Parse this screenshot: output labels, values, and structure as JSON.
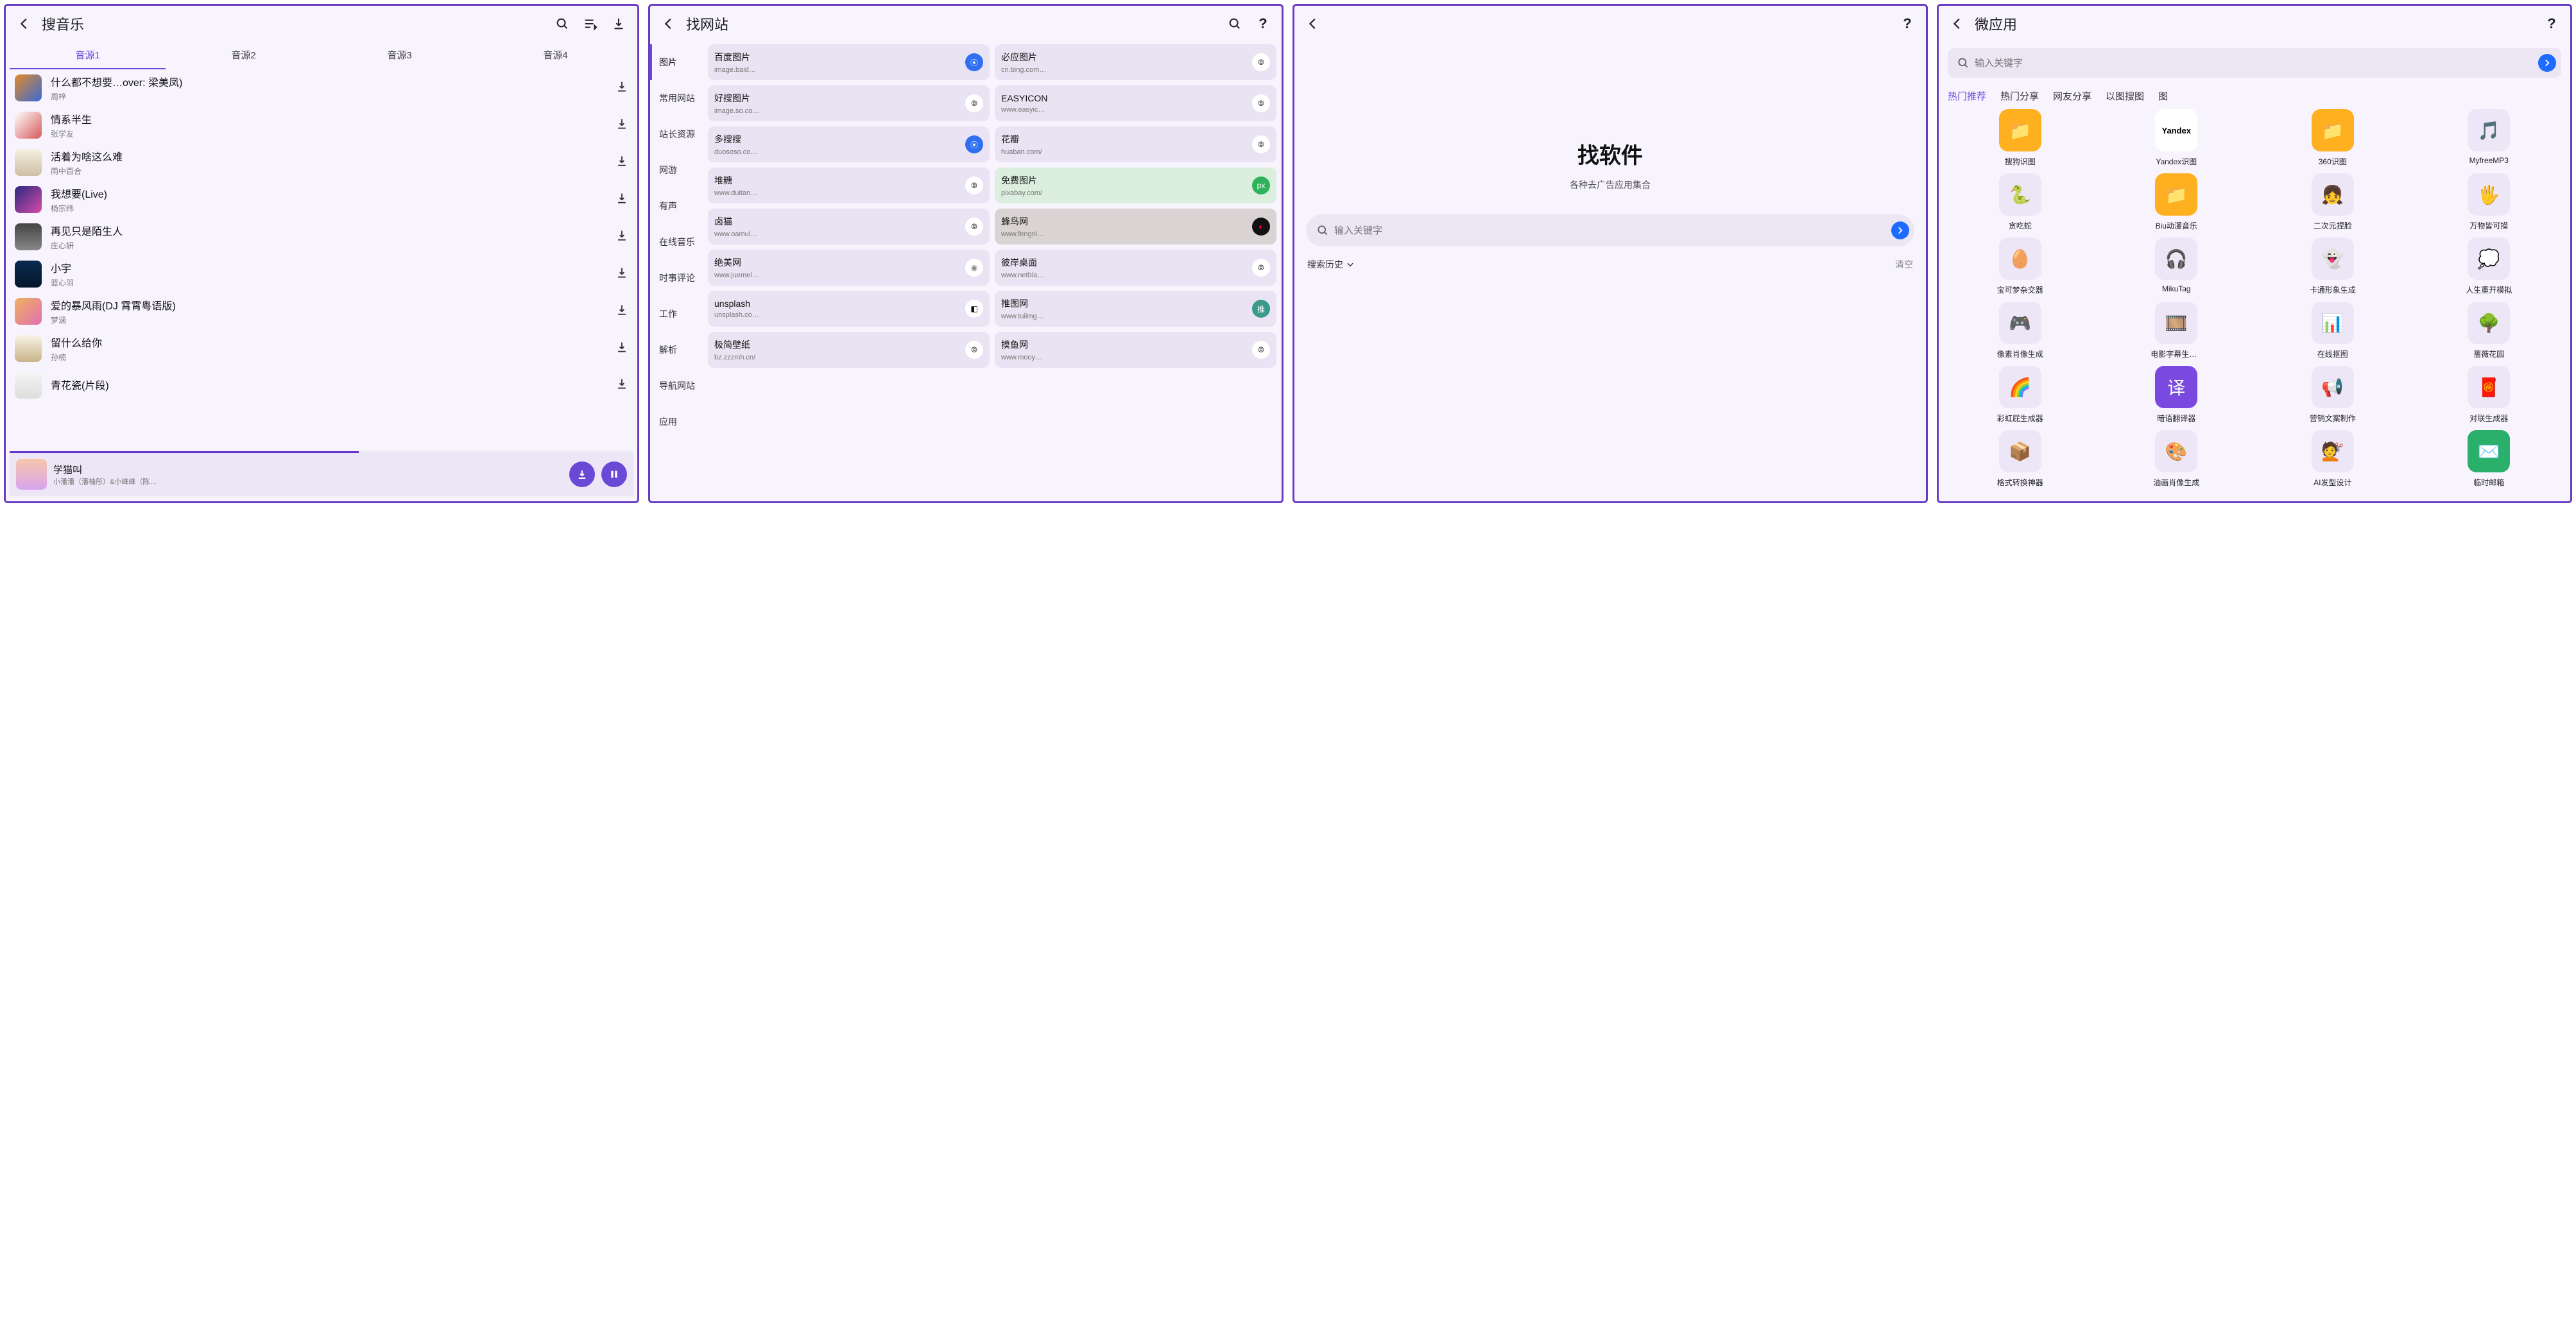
{
  "screen1": {
    "title": "搜音乐",
    "tabs": [
      "音源1",
      "音源2",
      "音源3",
      "音源4"
    ],
    "active_tab": 0,
    "songs": [
      {
        "title": "什么都不想要…over: 梁美凤)",
        "artist": "周梓",
        "thumb": "linear-gradient(135deg,#e08a2a,#3a6bd6)"
      },
      {
        "title": "情系半生",
        "artist": "张学友",
        "thumb": "linear-gradient(135deg,#fff,#d65a5a)"
      },
      {
        "title": "活着为啥这么难",
        "artist": "雨中百合",
        "thumb": "linear-gradient(#f5f0e1,#cdbfa5)"
      },
      {
        "title": "我想要(Live)",
        "artist": "杨宗纬",
        "thumb": "linear-gradient(135deg,#2a2a80,#d64aa8)"
      },
      {
        "title": "再见只是陌生人",
        "artist": "庄心妍",
        "thumb": "linear-gradient(#444,#888)"
      },
      {
        "title": "小宇",
        "artist": "蓝心羽",
        "thumb": "linear-gradient(#0a2a50,#05162a)"
      },
      {
        "title": "爱的暴风雨(DJ 霄霄粤语版)",
        "artist": "梦涵",
        "thumb": "linear-gradient(135deg,#f0b060,#e070b0)"
      },
      {
        "title": "留什么给你",
        "artist": "孙楠",
        "thumb": "linear-gradient(#f7f3e6,#c9b488)"
      },
      {
        "title": "青花瓷(片段)",
        "artist": "",
        "thumb": "linear-gradient(#f5f5f5,#ddd)"
      }
    ],
    "player": {
      "title": "学猫叫",
      "artist": "小潘潘（潘柚彤）&小峰峰（陈…"
    }
  },
  "screen2": {
    "title": "找网站",
    "categories": [
      "图片",
      "常用网站",
      "站长资源",
      "网游",
      "有声",
      "在线音乐",
      "时事评论",
      "工作",
      "解析",
      "导航网站",
      "应用"
    ],
    "active_cat": 0,
    "sites": [
      {
        "name": "百度图片",
        "url": "image.baid…",
        "iconText": "",
        "iconBg": "#2f6ff0",
        "iconColor": "#fff"
      },
      {
        "name": "必应图片",
        "url": "cn.bing.com…",
        "iconText": "⦾",
        "iconBg": "#fff",
        "iconColor": "#333"
      },
      {
        "name": "好搜图片",
        "url": "image.so.co…",
        "iconText": "⦾",
        "iconBg": "#fff",
        "iconColor": "#333"
      },
      {
        "name": "EASYICON",
        "url": "www.easyic…",
        "iconText": "⦾",
        "iconBg": "#fff",
        "iconColor": "#333"
      },
      {
        "name": "多搜搜",
        "url": "duososo.co…",
        "iconText": "",
        "iconBg": "#2f6ff0",
        "iconColor": "#fff"
      },
      {
        "name": "花瓣",
        "url": "huaban.com/",
        "iconText": "⦾",
        "iconBg": "#fff",
        "iconColor": "#333"
      },
      {
        "name": "堆糖",
        "url": "www.duitan…",
        "iconText": "⦾",
        "iconBg": "#fff",
        "iconColor": "#333"
      },
      {
        "name": "免费图片",
        "url": "pixabay.com/",
        "iconText": "px",
        "iconBg": "#2fb35a",
        "iconColor": "#fff",
        "cardBg": "#dcefdf"
      },
      {
        "name": "卤猫",
        "url": "www.oamul…",
        "iconText": "⦾",
        "iconBg": "#fff",
        "iconColor": "#333"
      },
      {
        "name": "蜂鸟网",
        "url": "www.fengni…",
        "iconText": "◐",
        "iconBg": "#111",
        "iconColor": "#f06",
        "cardBg": "#dad3d3"
      },
      {
        "name": "绝美网",
        "url": "www.juemei…",
        "iconText": "◉",
        "iconBg": "#fff",
        "iconColor": "#888"
      },
      {
        "name": "彼岸桌面",
        "url": "www.netbia…",
        "iconText": "⦾",
        "iconBg": "#fff",
        "iconColor": "#333"
      },
      {
        "name": "unsplash",
        "url": "unsplash.co…",
        "iconText": "◧",
        "iconBg": "#fff",
        "iconColor": "#111"
      },
      {
        "name": "推图网",
        "url": "www.tuiimg…",
        "iconText": "推",
        "iconBg": "#3a9a8a",
        "iconColor": "#fff"
      },
      {
        "name": "极简壁纸",
        "url": "bz.zzzmh.cn/",
        "iconText": "⦾",
        "iconBg": "#fff",
        "iconColor": "#333"
      },
      {
        "name": "摸鱼网",
        "url": "www.mooy…",
        "iconText": "⦾",
        "iconBg": "#fff",
        "iconColor": "#333"
      }
    ]
  },
  "screen3": {
    "big": "找软件",
    "sub": "各种去广告应用集合",
    "placeholder": "输入关键字",
    "history_label": "搜索历史",
    "clear_label": "清空"
  },
  "screen4": {
    "title": "微应用",
    "placeholder": "输入关键字",
    "tabs": [
      "热门推荐",
      "热门分享",
      "网友分享",
      "以图搜图",
      "图"
    ],
    "active_tab": 0,
    "apps": [
      {
        "label": "搜狗识图",
        "emoji": "📁",
        "bg": "#ffb020"
      },
      {
        "label": "Yandex识图",
        "emoji": "",
        "text": "Yandex",
        "bg": "#fff"
      },
      {
        "label": "360识图",
        "emoji": "📁",
        "bg": "#ffb020"
      },
      {
        "label": "MyfreeMP3",
        "emoji": "🎵",
        "bg": "transparent",
        "color": "#ff2a5a"
      },
      {
        "label": "贪吃蛇",
        "emoji": "🐍",
        "bg": "transparent"
      },
      {
        "label": "Biu动漫音乐",
        "emoji": "📁",
        "bg": "#ffb020"
      },
      {
        "label": "二次元捏脸",
        "emoji": "👧",
        "bg": "transparent"
      },
      {
        "label": "万物皆可摸",
        "emoji": "🖐️",
        "bg": "transparent"
      },
      {
        "label": "宝可梦杂交器",
        "emoji": "🥚",
        "bg": "transparent"
      },
      {
        "label": "MikuTag",
        "emoji": "🎧",
        "bg": "transparent",
        "color": "#3a7aff"
      },
      {
        "label": "卡通形象生成",
        "emoji": "👻",
        "bg": "transparent"
      },
      {
        "label": "人生重开模拟",
        "emoji": "💭",
        "bg": "transparent"
      },
      {
        "label": "像素肖像生成",
        "emoji": "🎮",
        "bg": "transparent"
      },
      {
        "label": "电影字幕生成…",
        "emoji": "🎞️",
        "bg": "transparent"
      },
      {
        "label": "在线抠图",
        "emoji": "📊",
        "bg": "transparent"
      },
      {
        "label": "蔷薇花园",
        "emoji": "🌳",
        "bg": "transparent",
        "color": "#2aa84a"
      },
      {
        "label": "彩虹屁生成器",
        "emoji": "🌈",
        "bg": "transparent"
      },
      {
        "label": "暗语翻译器",
        "emoji": "译",
        "bg": "#7a4ae0",
        "color": "#fff"
      },
      {
        "label": "营销文案制作",
        "emoji": "📢",
        "bg": "transparent",
        "color": "#ff3a6a"
      },
      {
        "label": "对联生成器",
        "emoji": "🧧",
        "bg": "transparent"
      },
      {
        "label": "格式转换神器",
        "emoji": "📦",
        "bg": "transparent",
        "color": "#3a7aff"
      },
      {
        "label": "油画肖像生成",
        "emoji": "🎨",
        "bg": "transparent"
      },
      {
        "label": "AI发型设计",
        "emoji": "💇",
        "bg": "transparent"
      },
      {
        "label": "临时邮箱",
        "emoji": "✉️",
        "bg": "#2ab06a",
        "color": "#fff"
      }
    ]
  }
}
